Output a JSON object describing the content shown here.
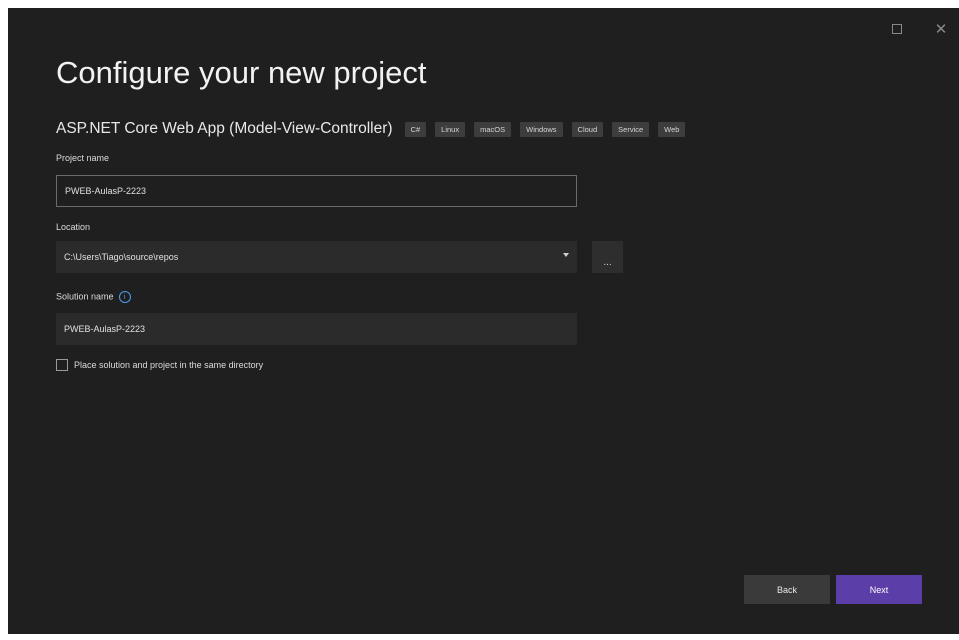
{
  "window": {
    "maximize_icon": "maximize-icon",
    "close_icon": "close-icon",
    "close_glyph": "✕"
  },
  "title": "Configure your new project",
  "template": {
    "name": "ASP.NET Core Web App (Model-View-Controller)",
    "tags": [
      "C#",
      "Linux",
      "macOS",
      "Windows",
      "Cloud",
      "Service",
      "Web"
    ]
  },
  "project_name": {
    "label": "Project name",
    "value": "PWEB-AulasP-2223"
  },
  "location": {
    "label": "Location",
    "value": "C:\\Users\\Tiago\\source\\repos",
    "browse_label": "..."
  },
  "solution_name": {
    "label": "Solution name",
    "info_glyph": "i",
    "value": "PWEB-AulasP-2223"
  },
  "same_directory": {
    "label": "Place solution and project in the same directory",
    "checked": false
  },
  "buttons": {
    "back": "Back",
    "next": "Next"
  },
  "colors": {
    "background": "#1f1f1f",
    "accent": "#5b3ea8",
    "info": "#4c9ff0"
  }
}
